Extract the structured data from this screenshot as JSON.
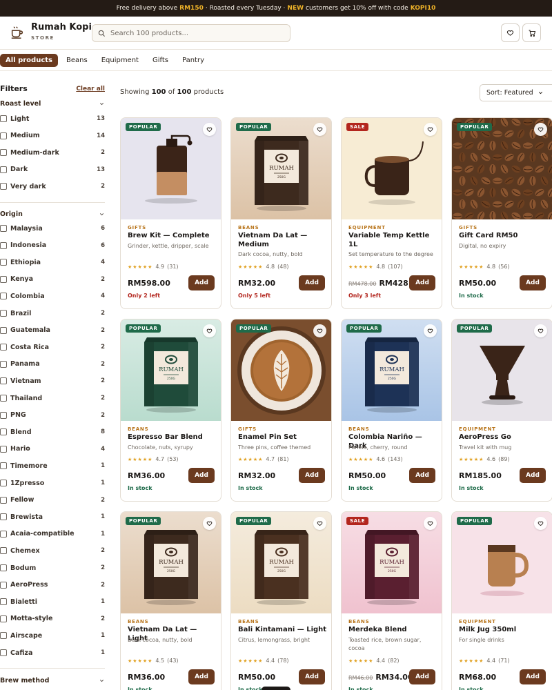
{
  "announcement": {
    "part1": "Free delivery above",
    "amount": "RM150",
    "part2": "· Roasted every Tuesday ·",
    "new_label": "NEW",
    "part3": "customers get 10% off with code",
    "code": "KOPI10"
  },
  "brand": {
    "name": "Rumah Kopi",
    "tagline": "STORE",
    "icon": "coffee-cup-icon"
  },
  "search": {
    "placeholder": "Search 100 products...",
    "icon": "search-icon"
  },
  "header_icons": {
    "wishlist": "heart-icon",
    "cart": "cart-icon"
  },
  "categories": [
    {
      "label": "All products",
      "active": true
    },
    {
      "label": "Beans",
      "active": false
    },
    {
      "label": "Equipment",
      "active": false
    },
    {
      "label": "Gifts",
      "active": false
    },
    {
      "label": "Pantry",
      "active": false
    }
  ],
  "filters": {
    "title": "Filters",
    "clear_label": "Clear all",
    "roast": {
      "title": "Roast level",
      "options": [
        {
          "label": "Light",
          "count": "13"
        },
        {
          "label": "Medium",
          "count": "14"
        },
        {
          "label": "Medium-dark",
          "count": "2"
        },
        {
          "label": "Dark",
          "count": "13"
        },
        {
          "label": "Very dark",
          "count": "2"
        }
      ]
    },
    "origin": {
      "title": "Origin",
      "options": [
        {
          "label": "Malaysia",
          "count": "6"
        },
        {
          "label": "Indonesia",
          "count": "6"
        },
        {
          "label": "Ethiopia",
          "count": "4"
        },
        {
          "label": "Kenya",
          "count": "2"
        },
        {
          "label": "Colombia",
          "count": "4"
        },
        {
          "label": "Brazil",
          "count": "2"
        },
        {
          "label": "Guatemala",
          "count": "2"
        },
        {
          "label": "Costa Rica",
          "count": "2"
        },
        {
          "label": "Panama",
          "count": "2"
        },
        {
          "label": "Vietnam",
          "count": "2"
        },
        {
          "label": "Thailand",
          "count": "2"
        },
        {
          "label": "PNG",
          "count": "2"
        },
        {
          "label": "Blend",
          "count": "8"
        },
        {
          "label": "Hario",
          "count": "4"
        },
        {
          "label": "Timemore",
          "count": "1"
        },
        {
          "label": "1Zpresso",
          "count": "1"
        },
        {
          "label": "Fellow",
          "count": "2"
        },
        {
          "label": "Brewista",
          "count": "1"
        },
        {
          "label": "Acaia-compatible",
          "count": "1"
        },
        {
          "label": "Chemex",
          "count": "2"
        },
        {
          "label": "Bodum",
          "count": "2"
        },
        {
          "label": "AeroPress",
          "count": "2"
        },
        {
          "label": "Bialetti",
          "count": "1"
        },
        {
          "label": "Motta-style",
          "count": "2"
        },
        {
          "label": "Airscape",
          "count": "1"
        },
        {
          "label": "Cafiza",
          "count": "1"
        }
      ]
    },
    "brew": {
      "title": "Brew method"
    }
  },
  "results": {
    "prefix": "Showing",
    "shown": "100",
    "of": "of",
    "total": "100",
    "suffix": "products"
  },
  "sort": {
    "label": "Sort: Featured"
  },
  "products": [
    {
      "badge": "POPULAR",
      "badge_type": "popular",
      "category": "GIFTS",
      "name": "Brew Kit — Complete",
      "desc": "Grinder, kettle, dripper, scale",
      "rating": "4.9",
      "reviews": "(31)",
      "price": "RM598.00",
      "old_price": "",
      "add_label": "Add",
      "stock": "Only 2 left",
      "stock_type": "low",
      "image": "grinder",
      "bg": "#e6e4ee"
    },
    {
      "badge": "POPULAR",
      "badge_type": "popular",
      "category": "BEANS",
      "name": "Vietnam Da Lat — Medium",
      "desc": "Dark cocoa, nutty, bold",
      "rating": "4.8",
      "reviews": "(48)",
      "price": "RM32.00",
      "old_price": "",
      "add_label": "Add",
      "stock": "Only 5 left",
      "stock_type": "low",
      "image": "bag",
      "bg": "#dcc2a6",
      "bag_color": "#3d2a1e",
      "bag_text": "RUMAH",
      "bag_weight": "250G"
    },
    {
      "badge": "SALE",
      "badge_type": "sale",
      "category": "EQUIPMENT",
      "name": "Variable Temp Kettle 1L",
      "desc": "Set temperature to the degree",
      "rating": "4.8",
      "reviews": "(107)",
      "price": "RM428.00",
      "old_price": "RM478.00",
      "add_label": "Add",
      "stock": "Only 3 left",
      "stock_type": "low",
      "image": "kettle",
      "bg": "#f7ecd4"
    },
    {
      "badge": "POPULAR",
      "badge_type": "popular",
      "category": "GIFTS",
      "name": "Gift Card RM50",
      "desc": "Digital, no expiry",
      "rating": "4.8",
      "reviews": "(56)",
      "price": "RM50.00",
      "old_price": "",
      "add_label": "Add",
      "stock": "In stock",
      "stock_type": "ok",
      "image": "beans",
      "bg": "#5b3a22"
    },
    {
      "badge": "POPULAR",
      "badge_type": "popular",
      "category": "BEANS",
      "name": "Espresso Bar Blend",
      "desc": "Chocolate, nuts, syrupy",
      "rating": "4.7",
      "reviews": "(53)",
      "price": "RM36.00",
      "old_price": "",
      "add_label": "Add",
      "stock": "In stock",
      "stock_type": "ok",
      "image": "bag",
      "bg": "#b9dcce",
      "bag_color": "#1f4b3a",
      "bag_text": "RUMAH",
      "bag_weight": "250G"
    },
    {
      "badge": "POPULAR",
      "badge_type": "popular",
      "category": "GIFTS",
      "name": "Enamel Pin Set",
      "desc": "Three pins, coffee themed",
      "rating": "4.7",
      "reviews": "(81)",
      "price": "RM32.00",
      "old_price": "",
      "add_label": "Add",
      "stock": "In stock",
      "stock_type": "ok",
      "image": "latte",
      "bg": "#7a4e2e"
    },
    {
      "badge": "POPULAR",
      "badge_type": "popular",
      "category": "BEANS",
      "name": "Colombia Nariño — Dark",
      "desc": "Panela, cherry, round",
      "rating": "4.6",
      "reviews": "(143)",
      "price": "RM50.00",
      "old_price": "",
      "add_label": "Add",
      "stock": "In stock",
      "stock_type": "ok",
      "image": "bag",
      "bg": "#a9c4e6",
      "bag_color": "#1d3256",
      "bag_text": "RUMAH",
      "bag_weight": "250G"
    },
    {
      "badge": "POPULAR",
      "badge_type": "popular",
      "category": "EQUIPMENT",
      "name": "AeroPress Go",
      "desc": "Travel kit with mug",
      "rating": "4.6",
      "reviews": "(89)",
      "price": "RM185.00",
      "old_price": "",
      "add_label": "Add",
      "stock": "In stock",
      "stock_type": "ok",
      "image": "dripper",
      "bg": "#e8e4ea"
    },
    {
      "badge": "POPULAR",
      "badge_type": "popular",
      "category": "BEANS",
      "name": "Vietnam Da Lat — Light",
      "desc": "Dark cocoa, nutty, bold",
      "rating": "4.5",
      "reviews": "(43)",
      "price": "RM36.00",
      "old_price": "",
      "add_label": "Add",
      "stock": "In stock",
      "stock_type": "ok",
      "image": "bag",
      "bg": "#dcc2a6",
      "bag_color": "#3d2a1e",
      "bag_text": "RUMAH",
      "bag_weight": "250G"
    },
    {
      "badge": "POPULAR",
      "badge_type": "popular",
      "category": "BEANS",
      "name": "Bali Kintamani — Light",
      "desc": "Citrus, lemongrass, bright",
      "rating": "4.4",
      "reviews": "(78)",
      "price": "RM50.00",
      "old_price": "",
      "add_label": "Add",
      "stock": "In stock",
      "stock_type": "ok",
      "image": "bag",
      "bg": "#ecdcc2",
      "bag_color": "#4a3020",
      "bag_text": "RUMAH",
      "bag_weight": "250G"
    },
    {
      "badge": "SALE",
      "badge_type": "sale",
      "category": "BEANS",
      "name": "Merdeka Blend",
      "desc": "Toasted rice, brown sugar, cocoa",
      "rating": "4.4",
      "reviews": "(82)",
      "price": "RM34.00",
      "old_price": "RM46.00",
      "add_label": "Add",
      "stock": "In stock",
      "stock_type": "ok",
      "image": "bag",
      "bg": "#f0c2cf",
      "bag_color": "#5a1f30",
      "bag_text": "RUMAH",
      "bag_weight": "250G"
    },
    {
      "badge": "POPULAR",
      "badge_type": "popular",
      "category": "EQUIPMENT",
      "name": "Milk Jug 350ml",
      "desc": "For single drinks",
      "rating": "4.4",
      "reviews": "(71)",
      "price": "RM68.00",
      "old_price": "",
      "add_label": "Add",
      "stock": "In stock",
      "stock_type": "ok",
      "image": "mug",
      "bg": "#f7e2e8"
    }
  ]
}
